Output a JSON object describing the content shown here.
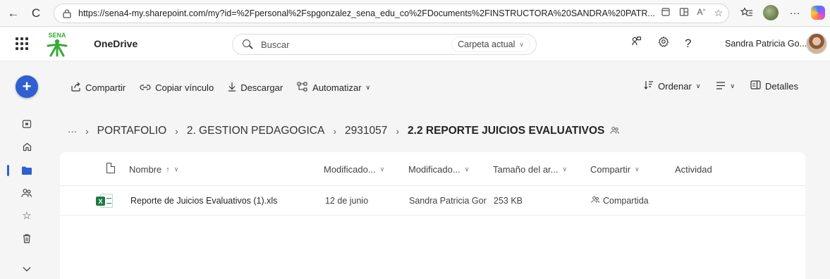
{
  "browser": {
    "url": "https://sena4-my.sharepoint.com/my?id=%2Fpersonal%2Fspgonzalez_sena_edu_co%2FDocuments%2FINSTRUCTORA%20SANDRA%20PATR...",
    "back_glyph": "←",
    "reload_glyph": "C"
  },
  "app": {
    "title": "OneDrive",
    "logo_text": "SENA"
  },
  "search": {
    "placeholder": "Buscar",
    "scope_label": "Carpeta actual"
  },
  "user": {
    "name": "Sandra Patricia Go..."
  },
  "commands": {
    "share": "Compartir",
    "copy_link": "Copiar vínculo",
    "download": "Descargar",
    "automate": "Automatizar",
    "sort": "Ordenar",
    "details": "Detalles"
  },
  "breadcrumb": {
    "overflow": "···",
    "items": [
      "PORTAFOLIO",
      "2. GESTION PEDAGOGICA",
      "2931057"
    ],
    "current": "2.2 REPORTE JUICIOS EVALUATIVOS"
  },
  "list": {
    "columns": {
      "name": "Nombre",
      "name_sort": "↑",
      "modified": "Modificado...",
      "modified_by": "Modificado...",
      "size": "Tamaño del ar...",
      "sharing": "Compartir",
      "activity": "Actividad"
    },
    "rows": [
      {
        "name": "Reporte de Juicios Evaluativos (1).xls",
        "modified": "12 de junio",
        "modified_by": "Sandra Patricia Gor",
        "size": "253 KB",
        "sharing": "Compartida"
      }
    ]
  },
  "colors": {
    "accent": "#2f5fd0",
    "excel_green": "#1d7a44",
    "sena_green": "#39a935"
  }
}
